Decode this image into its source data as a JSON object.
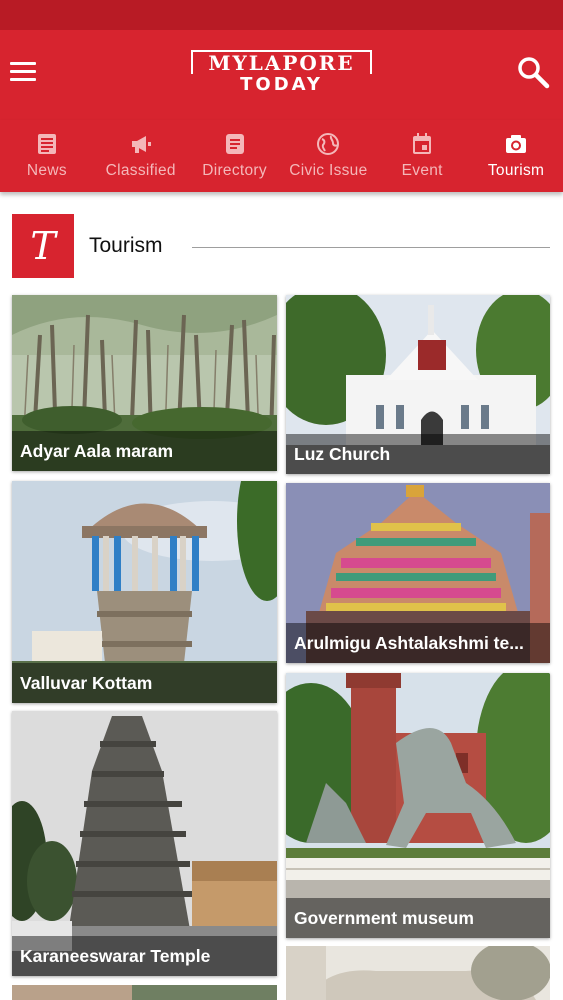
{
  "app": {
    "logo_top": "MYLAPORE",
    "logo_bottom": "TODAY",
    "menu_icon": "hamburger-menu-icon",
    "search_icon": "search-icon",
    "brand_color": "#d7242f"
  },
  "nav": {
    "items": [
      {
        "label": "News",
        "icon": "newspaper-icon",
        "active": false
      },
      {
        "label": "Classified",
        "icon": "megaphone-icon",
        "active": false
      },
      {
        "label": "Directory",
        "icon": "document-icon",
        "active": false
      },
      {
        "label": "Civic Issue",
        "icon": "globe-icon",
        "active": false
      },
      {
        "label": "Event",
        "icon": "calendar-icon",
        "active": false
      },
      {
        "label": "Tourism",
        "icon": "camera-icon",
        "active": true
      }
    ]
  },
  "section": {
    "badge": "T",
    "title": "Tourism"
  },
  "places": [
    {
      "name": "Adyar Aala maram"
    },
    {
      "name": "Luz Church"
    },
    {
      "name": "Valluvar Kottam"
    },
    {
      "name": "Arulmigu Ashtalakshmi te..."
    },
    {
      "name": "Karaneeswarar Temple"
    },
    {
      "name": "Government museum"
    }
  ]
}
